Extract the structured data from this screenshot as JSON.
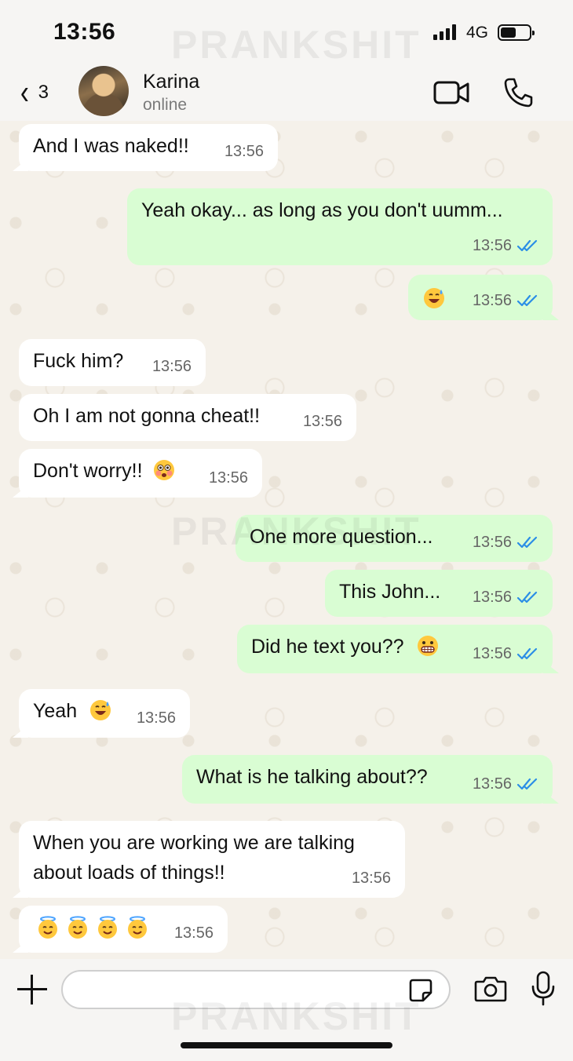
{
  "status": {
    "time": "13:56",
    "network": "4G"
  },
  "watermark": "PRANKSHIT",
  "header": {
    "back_count": "3",
    "name": "Karina",
    "status": "online"
  },
  "colors": {
    "incoming": "#ffffff",
    "outgoing": "#d9fdd3",
    "read_check": "#2b8ee6"
  },
  "messages": [
    {
      "dir": "in",
      "text": "And I was naked!!",
      "time": "13:56"
    },
    {
      "dir": "out",
      "text": "Yeah okay... as long as you don't uumm...",
      "time": "13:56",
      "read": true
    },
    {
      "dir": "out",
      "emoji": [
        "grinning-sweat-emoji"
      ],
      "time": "13:56",
      "read": true
    },
    {
      "dir": "in",
      "text": "Fuck him?",
      "time": "13:56"
    },
    {
      "dir": "in",
      "text": "Oh I am not gonna cheat!!",
      "time": "13:56"
    },
    {
      "dir": "in",
      "text": "Don't worry!!",
      "emoji": [
        "flushed-emoji"
      ],
      "time": "13:56"
    },
    {
      "dir": "out",
      "text": "One more question...",
      "time": "13:56",
      "read": true
    },
    {
      "dir": "out",
      "text": "This John...",
      "time": "13:56",
      "read": true
    },
    {
      "dir": "out",
      "text": "Did he text you??",
      "emoji": [
        "grimacing-emoji"
      ],
      "time": "13:56",
      "read": true
    },
    {
      "dir": "in",
      "text": "Yeah",
      "emoji": [
        "grinning-sweat-emoji"
      ],
      "time": "13:56"
    },
    {
      "dir": "out",
      "text": "What is he talking about??",
      "time": "13:56",
      "read": true
    },
    {
      "dir": "in",
      "text": "When you are working we are talking about loads of things!!",
      "time": "13:56"
    },
    {
      "dir": "in",
      "emoji": [
        "halo-emoji",
        "halo-emoji",
        "halo-emoji",
        "halo-emoji"
      ],
      "time": "13:56"
    }
  ],
  "input": {
    "placeholder": "",
    "value": ""
  }
}
